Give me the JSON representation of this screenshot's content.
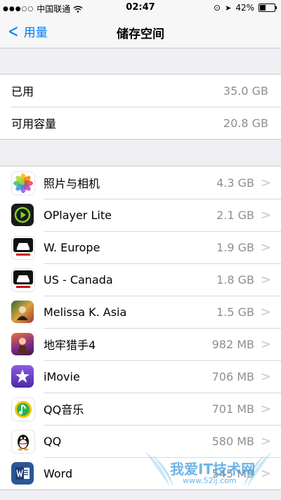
{
  "status": {
    "carrier": "中国联通",
    "time": "02:47",
    "battery_percent": "42%",
    "battery_level": 0.42
  },
  "nav": {
    "back_label": "用量",
    "title": "储存空间"
  },
  "storage": {
    "used_label": "已用",
    "used_value": "35.0 GB",
    "available_label": "可用容量",
    "available_value": "20.8 GB"
  },
  "apps": [
    {
      "name": "照片与相机",
      "size": "4.3 GB",
      "icon": "photos-icon"
    },
    {
      "name": "OPlayer Lite",
      "size": "2.1 GB",
      "icon": "oplayer-icon"
    },
    {
      "name": "W. Europe",
      "size": "1.9 GB",
      "icon": "tomtom-icon"
    },
    {
      "name": "US - Canada",
      "size": "1.8 GB",
      "icon": "tomtom-icon"
    },
    {
      "name": "Melissa K. Asia",
      "size": "1.5 GB",
      "icon": "game-icon"
    },
    {
      "name": "地牢猎手4",
      "size": "982 MB",
      "icon": "dungeon-hunter-icon"
    },
    {
      "name": "iMovie",
      "size": "706 MB",
      "icon": "imovie-icon"
    },
    {
      "name": "QQ音乐",
      "size": "701 MB",
      "icon": "qq-music-icon"
    },
    {
      "name": "QQ",
      "size": "580 MB",
      "icon": "qq-penguin-icon"
    },
    {
      "name": "Word",
      "size": "545 MB",
      "icon": "word-icon"
    }
  ],
  "watermark": {
    "text": "我爱IT技术网",
    "url": "www.52ij.com"
  }
}
